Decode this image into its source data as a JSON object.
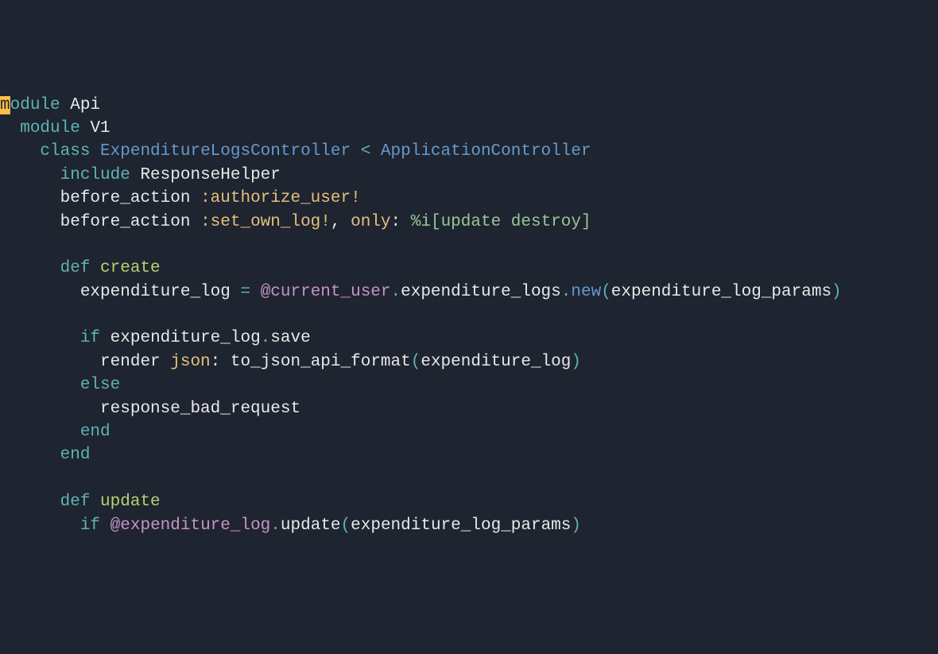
{
  "colors": {
    "bg": "#1e2430",
    "fg": "#e8e8e8",
    "kw": "#5fb3b3",
    "class": "#6699cc",
    "method": "#b8d16f",
    "symbol": "#e5c07b",
    "string": "#99c794",
    "ivar": "#c594c5",
    "cursor_bg": "#ffbf47"
  },
  "l1": {
    "cursor": "m",
    "rest": "odule",
    "sp": " ",
    "name": "Api"
  },
  "l2": {
    "indent": "  ",
    "kw": "module",
    "sp": " ",
    "name": "V1"
  },
  "l3": {
    "indent": "    ",
    "kw": "class",
    "sp": " ",
    "name": "ExpenditureLogsController",
    "op": " < ",
    "parent": "ApplicationController"
  },
  "l4": {
    "indent": "      ",
    "kw": "include",
    "sp": " ",
    "name": "ResponseHelper"
  },
  "l5": {
    "indent": "      ",
    "fn": "before_action ",
    "sym": ":authorize_user!"
  },
  "l6": {
    "indent": "      ",
    "fn": "before_action ",
    "sym": ":set_own_log!",
    "comma": ", ",
    "only": "only",
    "colon": ": ",
    "pct": "%i[",
    "inside": "update destroy",
    "close": "]"
  },
  "l7": {
    "blank": ""
  },
  "l8": {
    "indent": "      ",
    "kw": "def",
    "sp": " ",
    "name": "create"
  },
  "l9": {
    "indent": "        ",
    "lhs": "expenditure_log ",
    "eq": "= ",
    "ivar": "@current_user",
    "dot1": ".",
    "m1": "expenditure_logs",
    "dot2": ".",
    "m2": "new",
    "open": "(",
    "arg": "expenditure_log_params",
    "close": ")"
  },
  "l10": {
    "blank": ""
  },
  "l11": {
    "indent": "        ",
    "kw": "if",
    "sp": " ",
    "lhs": "expenditure_log",
    "dot": ".",
    "m": "save"
  },
  "l12": {
    "indent": "          ",
    "fn": "render ",
    "json": "json",
    "colon": ": ",
    "call": "to_json_api_format",
    "open": "(",
    "arg": "expenditure_log",
    "close": ")"
  },
  "l13": {
    "indent": "        ",
    "kw": "else"
  },
  "l14": {
    "indent": "          ",
    "fn": "response_bad_request"
  },
  "l15": {
    "indent": "        ",
    "kw": "end"
  },
  "l16": {
    "indent": "      ",
    "kw": "end"
  },
  "l17": {
    "blank": ""
  },
  "l18": {
    "indent": "      ",
    "kw": "def",
    "sp": " ",
    "name": "update"
  },
  "l19": {
    "indent": "        ",
    "kw": "if",
    "sp": " ",
    "ivar": "@expenditure_log",
    "dot": ".",
    "m": "update",
    "open": "(",
    "arg": "expenditure_log_params",
    "close": ")"
  }
}
